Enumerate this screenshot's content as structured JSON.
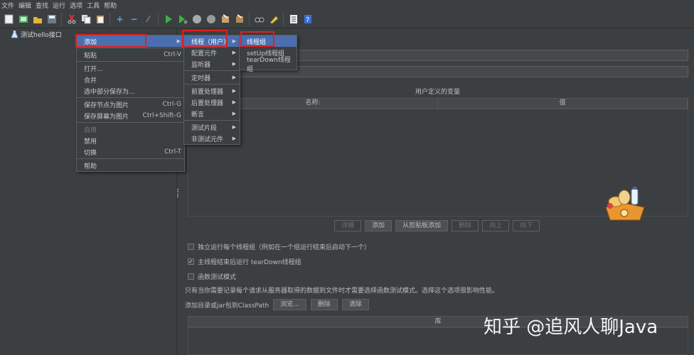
{
  "menubar": [
    "文件",
    "编辑",
    "查找",
    "运行",
    "选项",
    "工具",
    "帮助"
  ],
  "tree": {
    "item": "测试hello接口"
  },
  "right": {
    "user_vars_title": "用户定义的变量",
    "col_name": "名称:",
    "col_value": "值",
    "buttons": [
      "详细",
      "添加",
      "从剪贴板添加",
      "删除",
      "向上",
      "向下"
    ],
    "check1": "独立运行每个线程组（例如在一个组运行结束后启动下一个）",
    "check2": "主线程结束后运行 tearDown线程组",
    "check3": "函数测试模式",
    "description": "只有当你需要记录每个请求从服务器取得的数据到文件时才需要选择函数测试模式。选择这个选项很影响性能。",
    "classpath_label": "添加目录或jar包到ClassPath",
    "browse": "浏览...",
    "delete": "删除",
    "clear": "清除",
    "lib_header": "库"
  },
  "menu1": {
    "add": "添加",
    "paste": "粘贴",
    "paste_sc": "Ctrl-V",
    "open": "打开...",
    "merge": "合并",
    "save_selection": "选中部分保存为...",
    "save_node_img": "保存节点为图片",
    "save_node_sc": "Ctrl-G",
    "save_screen_img": "保存屏幕为图片",
    "save_screen_sc": "Ctrl+Shift-G",
    "enable": "启用",
    "disable": "禁用",
    "toggle": "切换",
    "toggle_sc": "Ctrl-T",
    "help": "帮助"
  },
  "menu2": [
    "线程（用户）",
    "配置元件",
    "监听器",
    "定时器",
    "前置处理器",
    "后置处理器",
    "断言",
    "测试片段",
    "非测试元件"
  ],
  "menu3": [
    "线程组",
    "setUp线程组",
    "tearDown线程组"
  ],
  "watermark": "知乎 @追风人聊Java"
}
